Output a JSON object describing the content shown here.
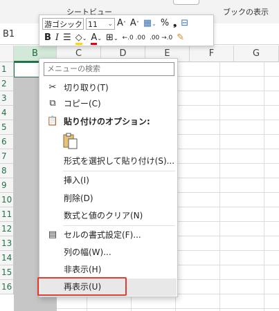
{
  "ribbon": {
    "sheet_view": "シートビュー",
    "book_view": "ブックの表示"
  },
  "formula_bar": {
    "name_box": "B1"
  },
  "columns": [
    "B",
    "C",
    "D",
    "E",
    "F",
    "G"
  ],
  "rows": [
    "1",
    "2",
    "3",
    "4",
    "5",
    "6",
    "7",
    "8",
    "9",
    "10",
    "11",
    "12",
    "13",
    "14",
    "15",
    "16"
  ],
  "mini_toolbar": {
    "font_name": "游ゴシック",
    "font_size": "11",
    "grow_font": "A",
    "shrink_font": "A",
    "number_format_symbol": "%",
    "comma_symbol": "❟",
    "bold": "B",
    "italic": "I",
    "font_color_letter": "A",
    "inc_decimal": "←.0 .00",
    "dec_decimal": ".00 →.0",
    "colors": {
      "fill": "#ffd800",
      "font": "#e3001b"
    }
  },
  "context_menu": {
    "search_placeholder": "メニューの検索",
    "items": [
      {
        "label": "切り取り(T)",
        "icon": "scissors-icon"
      },
      {
        "label": "コピー(C)",
        "icon": "copy-icon"
      },
      {
        "label": "貼り付けのオプション:",
        "icon": "clipboard-icon"
      },
      {
        "label": "形式を選択して貼り付け(S)..."
      },
      {
        "label": "挿入(I)"
      },
      {
        "label": "削除(D)"
      },
      {
        "label": "数式と値のクリア(N)"
      },
      {
        "label": "セルの書式設定(F)...",
        "icon": "format-cells-icon"
      },
      {
        "label": "列の幅(W)..."
      },
      {
        "label": "非表示(H)"
      },
      {
        "label": "再表示(U)",
        "highlighted": true
      }
    ]
  },
  "accent_colors": {
    "excel_green": "#217346",
    "highlight_red": "#e53b2c"
  }
}
